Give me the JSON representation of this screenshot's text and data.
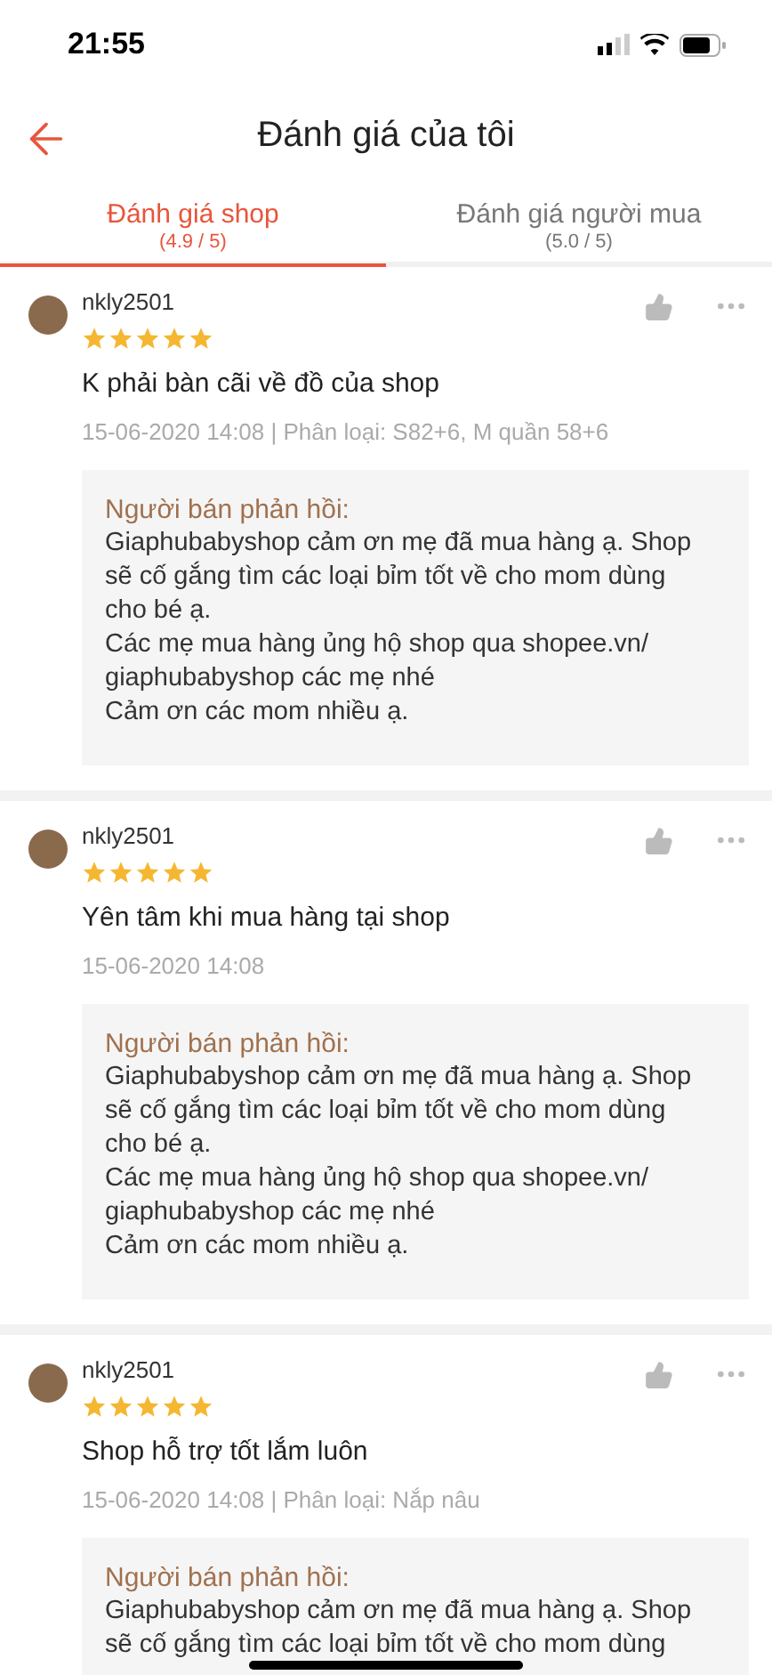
{
  "status_bar": {
    "time": "21:55"
  },
  "header": {
    "title": "Đánh giá của tôi"
  },
  "tabs": [
    {
      "label": "Đánh giá shop",
      "rating": "(4.9 / 5)",
      "selected": true
    },
    {
      "label": "Đánh giá người mua",
      "rating": "(5.0 / 5)",
      "selected": false
    }
  ],
  "reviews": [
    {
      "username": "nkly2501",
      "stars": 5,
      "comment": "K phải bàn cãi về đồ của shop",
      "meta": "15-06-2020 14:08 | Phân loại: S82+6, M quần 58+6",
      "reply_label": "Người bán phản hồi:",
      "reply_text": "Giaphubabyshop cảm ơn mẹ đã mua hàng ạ. Shop sẽ cố gắng tìm các loại bỉm tốt về cho mom dùng cho bé ạ.\nCác mẹ mua hàng ủng hộ shop qua shopee.vn/\ngiaphubabyshop các mẹ nhé\nCảm ơn các mom nhiều ạ."
    },
    {
      "username": "nkly2501",
      "stars": 5,
      "comment": "Yên tâm khi mua hàng tại shop",
      "meta": "15-06-2020 14:08",
      "reply_label": "Người bán phản hồi:",
      "reply_text": "Giaphubabyshop cảm ơn mẹ đã mua hàng ạ. Shop sẽ cố gắng tìm các loại bỉm tốt về cho mom dùng cho bé ạ.\nCác mẹ mua hàng ủng hộ shop qua shopee.vn/\ngiaphubabyshop các mẹ nhé\nCảm ơn các mom nhiều ạ."
    },
    {
      "username": "nkly2501",
      "stars": 5,
      "comment": "Shop hỗ trợ tốt lắm luôn",
      "meta": "15-06-2020 14:08 | Phân loại: Nắp nâu",
      "reply_label": "Người bán phản hồi:",
      "reply_text": "Giaphubabyshop cảm ơn mẹ đã mua hàng ạ. Shop sẽ cố gắng tìm các loại bỉm tốt về cho mom dùng"
    }
  ]
}
